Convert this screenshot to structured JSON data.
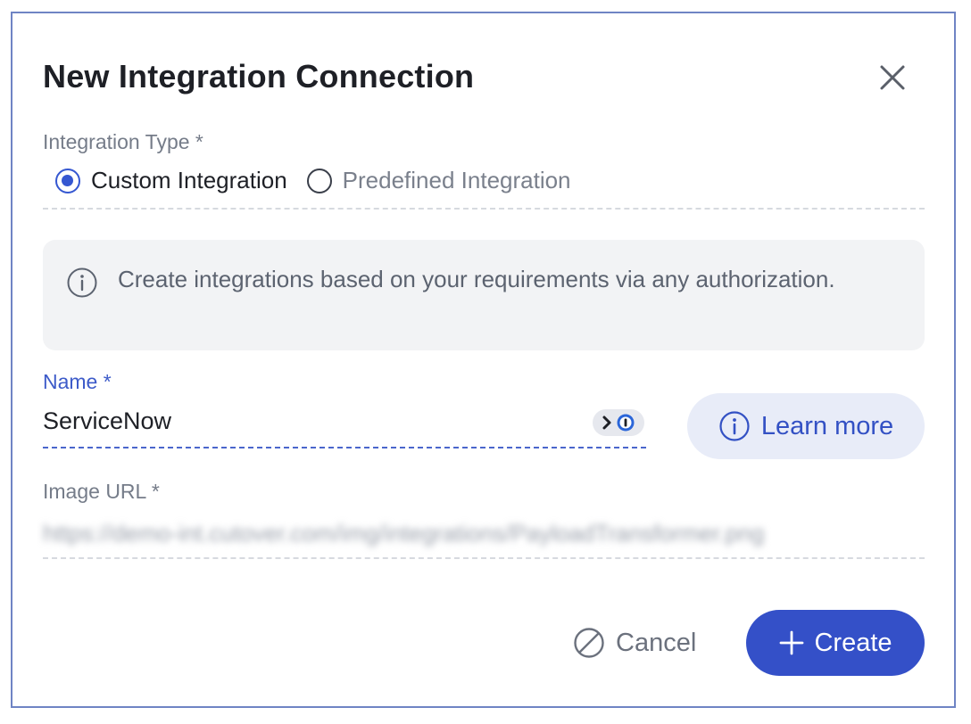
{
  "dialog": {
    "title": "New Integration Connection",
    "close_icon": "close-icon"
  },
  "integration_type": {
    "label": "Integration Type *",
    "options": [
      {
        "label": "Custom Integration",
        "selected": true
      },
      {
        "label": "Predefined Integration",
        "selected": false
      }
    ]
  },
  "info": {
    "icon": "info-icon",
    "text": "Create integrations based on your requirements via any authorization."
  },
  "name_field": {
    "label": "Name *",
    "value": "ServiceNow",
    "badge_icon": "password-manager-icon"
  },
  "learn_more": {
    "icon": "info-icon",
    "label": "Learn more"
  },
  "image_url_field": {
    "label": "Image URL *",
    "value": "https://demo-int.cutover.com/img/integrations/PayloadTransformer.png"
  },
  "footer": {
    "cancel_label": "Cancel",
    "create_label": "Create"
  },
  "colors": {
    "accent": "#3450c8",
    "active_label": "#3d5bc9",
    "info_bg": "#f2f3f5",
    "learn_bg": "#e8ecf8"
  }
}
